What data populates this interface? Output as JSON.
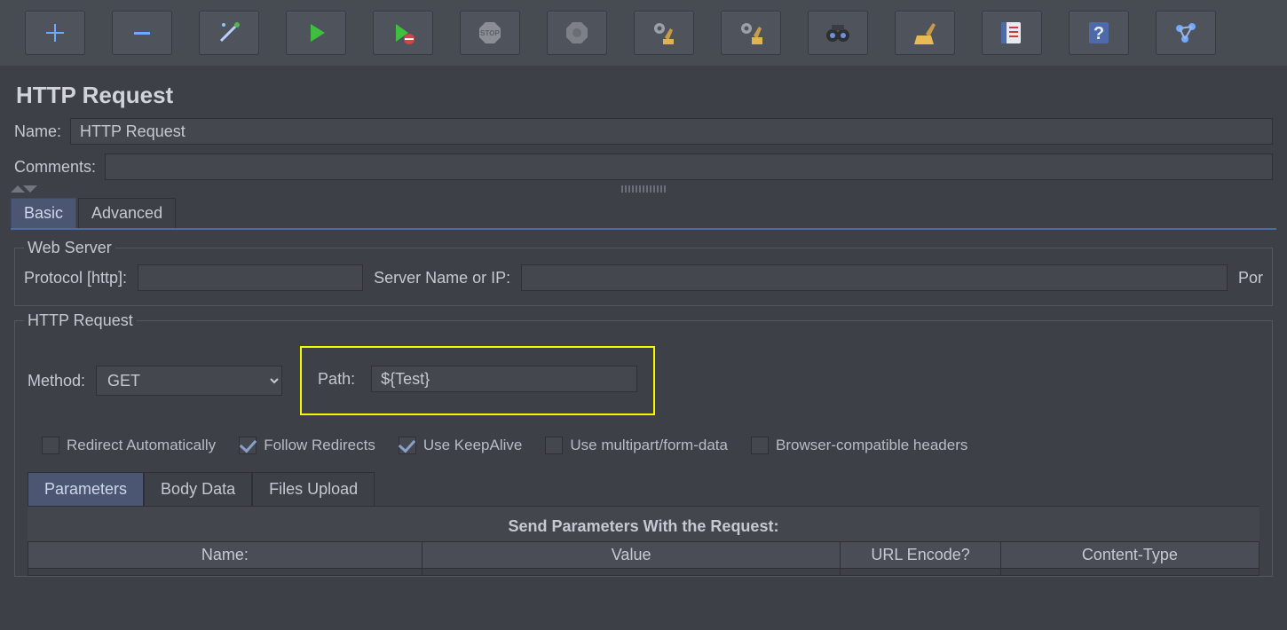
{
  "toolbar": {
    "icons": [
      "plus",
      "minus",
      "wand",
      "play",
      "play-no",
      "stop",
      "stop-dis",
      "gears-broom",
      "gear-broom",
      "binoculars",
      "broom",
      "list",
      "help",
      "molecule"
    ]
  },
  "title": "HTTP Request",
  "name": {
    "label": "Name:",
    "value": "HTTP Request"
  },
  "comments": {
    "label": "Comments:"
  },
  "topTabs": {
    "basic": "Basic",
    "advanced": "Advanced"
  },
  "webServer": {
    "legend": "Web Server",
    "protoLabel": "Protocol [http]:",
    "serverLabel": "Server Name or IP:",
    "portLabel": "Por"
  },
  "httpReq": {
    "legend": "HTTP Request",
    "methodLabel": "Method:",
    "method": "GET",
    "pathLabel": "Path:",
    "path": "${Test}",
    "checks": {
      "redirectAuto": "Redirect Automatically",
      "followRedirects": "Follow Redirects",
      "keepAlive": "Use KeepAlive",
      "multipart": "Use multipart/form-data",
      "browserHeaders": "Browser-compatible headers"
    },
    "subtabs": {
      "params": "Parameters",
      "body": "Body Data",
      "files": "Files Upload"
    },
    "paramTitle": "Send Parameters With the Request:",
    "cols": {
      "name": "Name:",
      "value": "Value",
      "enc": "URL Encode?",
      "ctype": "Content-Type"
    }
  }
}
